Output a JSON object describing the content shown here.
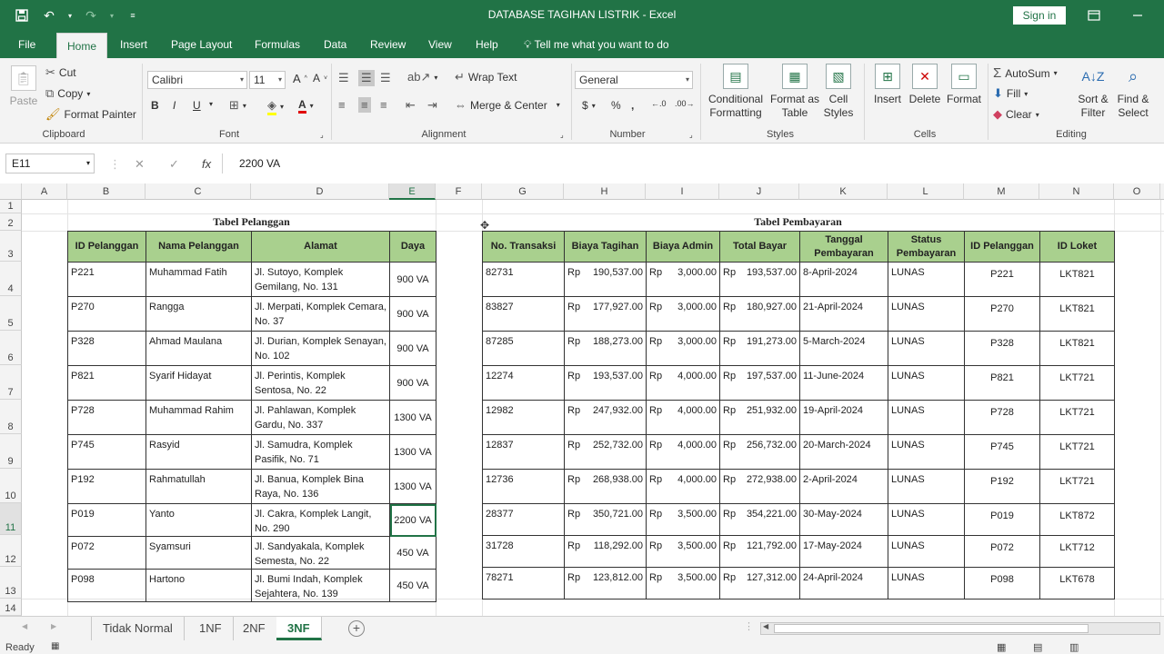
{
  "window": {
    "title": "DATABASE TAGIHAN LISTRIK  -  Excel",
    "sign_in": "Sign in"
  },
  "ribbon_tabs": [
    "File",
    "Home",
    "Insert",
    "Page Layout",
    "Formulas",
    "Data",
    "Review",
    "View",
    "Help"
  ],
  "tell_me": "Tell me what you want to do",
  "clipboard": {
    "paste": "Paste",
    "cut": "Cut",
    "copy": "Copy",
    "format_painter": "Format Painter",
    "label": "Clipboard"
  },
  "font": {
    "name": "Calibri",
    "size": "11",
    "label": "Font"
  },
  "alignment": {
    "wrap_text": "Wrap Text",
    "merge_center": "Merge & Center",
    "label": "Alignment"
  },
  "number": {
    "format": "General",
    "label": "Number"
  },
  "styles": {
    "conditional_1": "Conditional",
    "conditional_2": "Formatting",
    "format_as_1": "Format as",
    "format_as_2": "Table",
    "cell_styles_1": "Cell",
    "cell_styles_2": "Styles",
    "label": "Styles"
  },
  "cells": {
    "insert": "Insert",
    "delete": "Delete",
    "format": "Format",
    "label": "Cells"
  },
  "editing": {
    "autosum": "AutoSum",
    "fill": "Fill",
    "clear": "Clear",
    "sort_1": "Sort &",
    "sort_2": "Filter",
    "find_1": "Find &",
    "find_2": "Select",
    "label": "Editing"
  },
  "formula_bar": {
    "name_box": "E11",
    "value": "2200 VA"
  },
  "columns": [
    "A",
    "B",
    "C",
    "D",
    "E",
    "F",
    "G",
    "H",
    "I",
    "J",
    "K",
    "L",
    "M",
    "N",
    "O"
  ],
  "rows": [
    "1",
    "2",
    "3",
    "4",
    "5",
    "6",
    "7",
    "8",
    "9",
    "10",
    "11",
    "12",
    "13",
    "14"
  ],
  "pelanggan": {
    "title": "Tabel Pelanggan",
    "headers": [
      "ID Pelanggan",
      "Nama Pelanggan",
      "Alamat",
      "Daya"
    ],
    "rows": [
      [
        "P221",
        "Muhammad Fatih",
        "Jl. Sutoyo, Komplek Gemilang, No. 131",
        "900 VA"
      ],
      [
        "P270",
        "Rangga",
        "Jl. Merpati, Komplek Cemara, No. 37",
        "900 VA"
      ],
      [
        "P328",
        "Ahmad Maulana",
        "Jl. Durian, Komplek Senayan, No. 102",
        "900 VA"
      ],
      [
        "P821",
        "Syarif Hidayat",
        "Jl. Perintis, Komplek Sentosa, No. 22",
        "900 VA"
      ],
      [
        "P728",
        "Muhammad Rahim",
        "Jl. Pahlawan, Komplek Gardu, No. 337",
        "1300 VA"
      ],
      [
        "P745",
        "Rasyid",
        "Jl. Samudra, Komplek Pasifik, No. 71",
        "1300 VA"
      ],
      [
        "P192",
        "Rahmatullah",
        "Jl. Banua, Komplek Bina Raya, No. 136",
        "1300 VA"
      ],
      [
        "P019",
        "Yanto",
        "Jl. Cakra, Komplek Langit, No. 290",
        "2200 VA"
      ],
      [
        "P072",
        "Syamsuri",
        "Jl. Sandyakala, Komplek Semesta, No. 22",
        "450 VA"
      ],
      [
        "P098",
        "Hartono",
        "Jl. Bumi Indah, Komplek Sejahtera, No. 139",
        "450 VA"
      ]
    ]
  },
  "pembayaran": {
    "title": "Tabel Pembayaran",
    "headers": [
      "No. Transaksi",
      "Biaya Tagihan",
      "Biaya Admin",
      "Total Bayar",
      "Tanggal Pembayaran",
      "Status Pembayaran",
      "ID Pelanggan",
      "ID Loket"
    ],
    "currency": "Rp",
    "rows": [
      [
        "82731",
        "190,537.00",
        "3,000.00",
        "193,537.00",
        "8-April-2024",
        "LUNAS",
        "P221",
        "LKT821"
      ],
      [
        "83827",
        "177,927.00",
        "3,000.00",
        "180,927.00",
        "21-April-2024",
        "LUNAS",
        "P270",
        "LKT821"
      ],
      [
        "87285",
        "188,273.00",
        "3,000.00",
        "191,273.00",
        "5-March-2024",
        "LUNAS",
        "P328",
        "LKT821"
      ],
      [
        "12274",
        "193,537.00",
        "4,000.00",
        "197,537.00",
        "11-June-2024",
        "LUNAS",
        "P821",
        "LKT721"
      ],
      [
        "12982",
        "247,932.00",
        "4,000.00",
        "251,932.00",
        "19-April-2024",
        "LUNAS",
        "P728",
        "LKT721"
      ],
      [
        "12837",
        "252,732.00",
        "4,000.00",
        "256,732.00",
        "20-March-2024",
        "LUNAS",
        "P745",
        "LKT721"
      ],
      [
        "12736",
        "268,938.00",
        "4,000.00",
        "272,938.00",
        "2-April-2024",
        "LUNAS",
        "P192",
        "LKT721"
      ],
      [
        "28377",
        "350,721.00",
        "3,500.00",
        "354,221.00",
        "30-May-2024",
        "LUNAS",
        "P019",
        "LKT872"
      ],
      [
        "31728",
        "118,292.00",
        "3,500.00",
        "121,792.00",
        "17-May-2024",
        "LUNAS",
        "P072",
        "LKT712"
      ],
      [
        "78271",
        "123,812.00",
        "3,500.00",
        "127,312.00",
        "24-April-2024",
        "LUNAS",
        "P098",
        "LKT678"
      ]
    ]
  },
  "sheets": [
    "Tidak Normal",
    "1NF",
    "2NF",
    "3NF"
  ],
  "active_sheet": "3NF",
  "status": "Ready"
}
